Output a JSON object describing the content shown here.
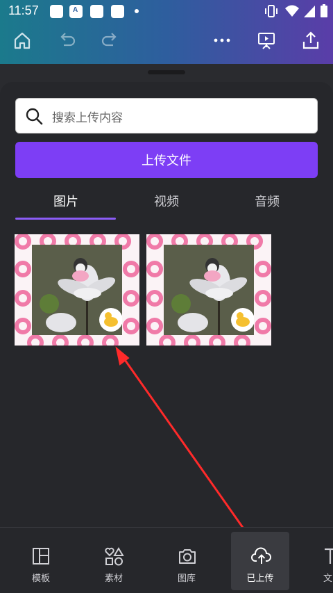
{
  "status_bar": {
    "time": "11:57",
    "notif_letter": "A"
  },
  "search": {
    "placeholder": "搜索上传内容"
  },
  "upload_button": {
    "label": "上传文件"
  },
  "tabs": [
    {
      "label": "图片",
      "selected": true
    },
    {
      "label": "视频",
      "selected": false
    },
    {
      "label": "音频",
      "selected": false
    }
  ],
  "uploads": [
    {
      "type": "image"
    },
    {
      "type": "image"
    }
  ],
  "bottom_nav": [
    {
      "label": "模板",
      "icon": "layout-icon",
      "active": false
    },
    {
      "label": "素材",
      "icon": "elements-icon",
      "active": false
    },
    {
      "label": "图库",
      "icon": "camera-icon",
      "active": false
    },
    {
      "label": "已上传",
      "icon": "cloud-upload-icon",
      "active": true
    },
    {
      "label": "文",
      "icon": "text-icon",
      "active": false
    }
  ],
  "colors": {
    "accent": "#7d3ef5",
    "annotation_arrow": "#ff2a2a"
  }
}
